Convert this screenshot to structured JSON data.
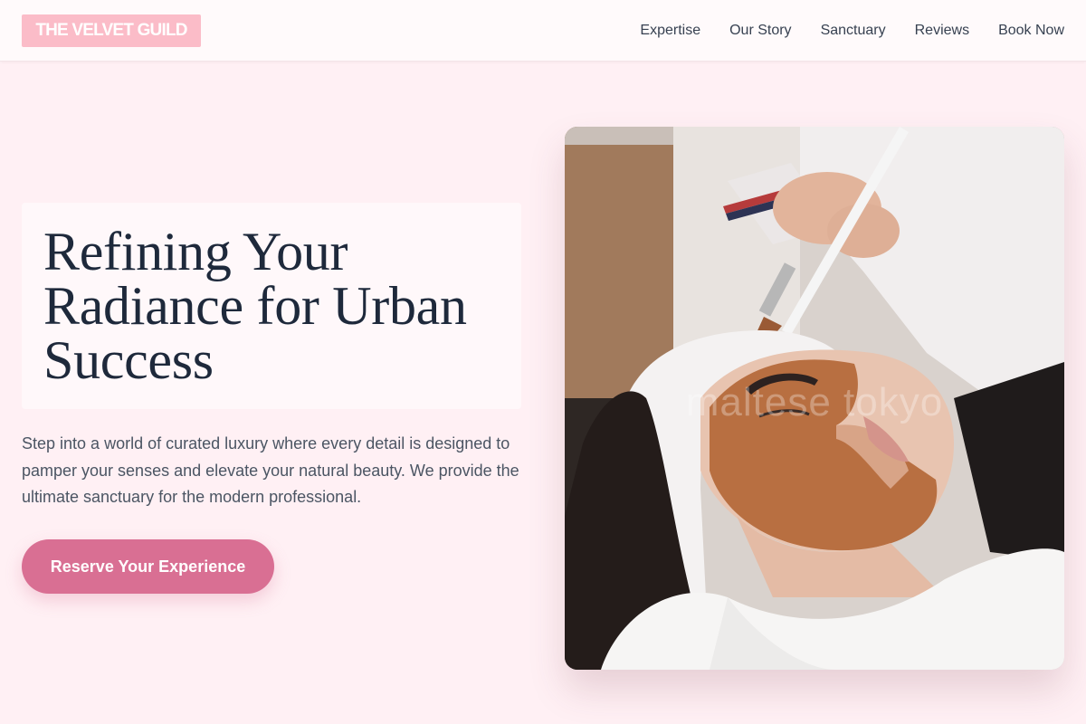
{
  "brand": {
    "logo_text": "THE VELVET GUILD"
  },
  "nav": {
    "items": [
      "Expertise",
      "Our Story",
      "Sanctuary",
      "Reviews",
      "Book Now"
    ]
  },
  "hero": {
    "headline_lines": [
      "Refining Your",
      "Radiance for Urban",
      "Success"
    ],
    "lede": "Step into a world of curated luxury where every detail is designed to pamper your senses and elevate your natural beauty. We provide the ultimate sanctuary for the modern professional.",
    "cta_label": "Reserve Your Experience"
  },
  "image": {
    "subject": "facial-treatment-photo",
    "watermark_text": "maltese tokyo"
  },
  "colors": {
    "page_bg": "#fff0f4",
    "logo_bg": "#fbbcc8",
    "accent": "#d96f93",
    "heading": "#1e293b",
    "body_text": "#4b5563"
  }
}
